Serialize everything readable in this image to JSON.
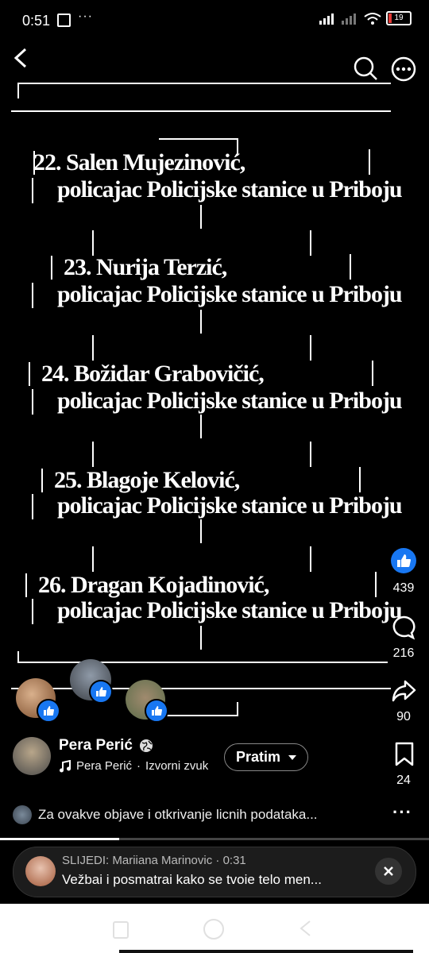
{
  "status_bar": {
    "time": "0:51",
    "battery": "19"
  },
  "video": {
    "entries": [
      {
        "name": "22. Salen Mujezinović,",
        "role": "policajac Policijske stanice u Priboju"
      },
      {
        "name": "23. Nurija Terzić,",
        "role": "policajac Policijske stanice u Priboju"
      },
      {
        "name": "24. Božidar Grabovičić,",
        "role": "policajac Policijske stanice u Priboju"
      },
      {
        "name": "25. Blagoje Kelović,",
        "role": "policajac Policijske stanice u Priboju"
      },
      {
        "name": "26. Dragan Kojadinović,",
        "role": "policajac Policijske stanice u Priboju"
      }
    ]
  },
  "actions": {
    "likes": "439",
    "comments": "216",
    "shares": "90",
    "saves": "24"
  },
  "post": {
    "author": "Pera Perić",
    "audio_author": "Pera Perić",
    "audio_label": "Izvorni zvuk",
    "follow_label": "Pratim",
    "caption": "Za ovakve objave i otkrivanje licnih podataka..."
  },
  "toast": {
    "prefix": "SLIJEDI:",
    "user": "Mariiana Marinovic",
    "time": "0:31",
    "message": "Vežbai i posmatrai kako se tvoie telo men..."
  },
  "colors": {
    "accent": "#1877f2",
    "battery": "#e53935"
  }
}
